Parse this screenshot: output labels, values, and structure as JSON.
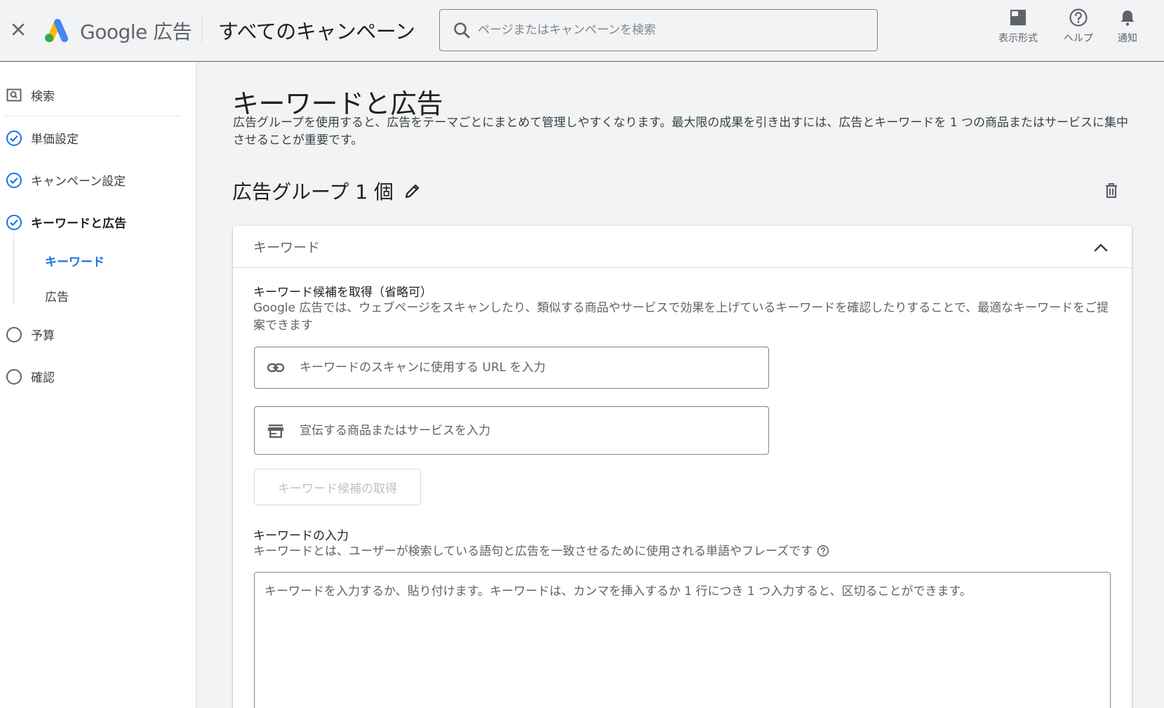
{
  "header": {
    "brand": "Google 広告",
    "page_title": "すべてのキャンペーン",
    "search_placeholder": "ページまたはキャンペーンを検索",
    "actions": [
      {
        "label": "表示形式",
        "icon": "display-format-icon"
      },
      {
        "label": "ヘルプ",
        "icon": "help-icon"
      },
      {
        "label": "通知",
        "icon": "bell-icon"
      }
    ]
  },
  "sidebar": {
    "items": [
      {
        "label": "検索",
        "icon": "search-box-icon",
        "state": "done"
      },
      {
        "label": "単価設定",
        "icon": "check-circle-icon",
        "state": "done"
      },
      {
        "label": "キャンペーン設定",
        "icon": "check-circle-icon",
        "state": "done"
      },
      {
        "label": "キーワードと広告",
        "icon": "check-circle-icon",
        "state": "current"
      },
      {
        "label": "予算",
        "icon": "empty-circle-icon",
        "state": "todo"
      },
      {
        "label": "確認",
        "icon": "empty-circle-icon",
        "state": "todo"
      }
    ],
    "subitems": [
      {
        "label": "キーワード",
        "active": true
      },
      {
        "label": "広告",
        "active": false
      }
    ]
  },
  "main": {
    "title": "キーワードと広告",
    "description": "広告グループを使用すると、広告をテーマごとにまとめて管理しやすくなります。最大限の成果を引き出すには、広告とキーワードを 1 つの商品またはサービスに集中させることが重要です。",
    "ad_group_title": "広告グループ 1 個"
  },
  "keywords_card": {
    "header": "キーワード",
    "suggest_title": "キーワード候補を取得（省略可）",
    "suggest_desc": "Google 広告では、ウェブページをスキャンしたり、類似する商品やサービスで効果を上げているキーワードを確認したりすることで、最適なキーワードをご提案できます",
    "url_placeholder": "キーワードのスキャンに使用する URL を入力",
    "product_placeholder": "宣伝する商品またはサービスを入力",
    "get_suggestions_label": "キーワード候補の取得",
    "enter_title": "キーワードの入力",
    "enter_desc": "キーワードとは、ユーザーが検索している語句と広告を一致させるために使用される単語やフレーズです",
    "textarea_placeholder": "キーワードを入力するか、貼り付けます。キーワードは、カンマを挿入するか 1 行につき 1 つ入力すると、区切ることができます。"
  },
  "colors": {
    "accent": "#1a73e8",
    "logo_blue": "#4285f4",
    "logo_yellow": "#fbbc04",
    "logo_green": "#34a853"
  }
}
